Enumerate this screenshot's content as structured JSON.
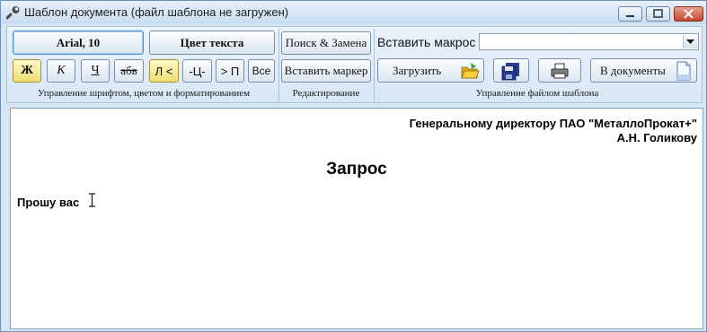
{
  "window": {
    "title": "Шаблон документа (файл шаблона не загружен)"
  },
  "toolbar": {
    "font_button": "Arial, 10",
    "text_color_button": "Цвет текста",
    "bold": "Ж",
    "italic": "К",
    "underline": "Ч",
    "strike": "абв",
    "align_left": "Л <",
    "align_center": "-Ц-",
    "align_right": "> П",
    "align_all": "Все",
    "search_replace": "Поиск & Замена",
    "insert_marker": "Вставить маркер",
    "insert_macro_label": "Вставить макрос",
    "macro_value": "",
    "load_button": "Загрузить",
    "to_documents_button": "В документы"
  },
  "groups": {
    "font_group": "Управление шрифтом, цветом и форматированием",
    "edit_group": "Редактирование",
    "file_group": "Управление файлом шаблона"
  },
  "document": {
    "recipient_line1": "Генеральному директору ПАО \"МеталлоПрокат+\"",
    "recipient_line2": "А.Н. Голикову",
    "heading": "Запрос",
    "body": "Прошу вас"
  },
  "colors": {
    "accent_yellow": "#eedd72",
    "window_blue": "#d6e6f5",
    "close_red": "#c2452d"
  }
}
